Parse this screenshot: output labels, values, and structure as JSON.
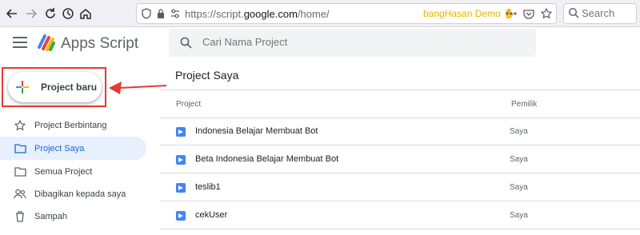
{
  "browser": {
    "url_prefix": "https://script.",
    "url_domain": "google.com",
    "url_path": "/home/",
    "extension_label": "bangHasan Demo",
    "search_placeholder": "Search"
  },
  "app": {
    "title": "Apps Script",
    "search_placeholder": "Cari Nama Project"
  },
  "sidebar": {
    "new_button_label": "Project baru",
    "items": [
      {
        "label": "Project Berbintang",
        "icon": "star-icon"
      },
      {
        "label": "Project Saya",
        "icon": "folder-icon"
      },
      {
        "label": "Semua Project",
        "icon": "folder-icon"
      },
      {
        "label": "Dibagikan kepada saya",
        "icon": "people-icon"
      },
      {
        "label": "Sampah",
        "icon": "trash-icon"
      }
    ],
    "active_index": 1
  },
  "main": {
    "title": "Project Saya",
    "columns": [
      "Project",
      "Pemilik"
    ],
    "rows": [
      {
        "name": "Indonesia Belajar Membuat Bot",
        "owner": "Saya"
      },
      {
        "name": "Beta Indonesia Belajar Membuat Bot",
        "owner": "Saya"
      },
      {
        "name": "teslib1",
        "owner": "Saya"
      },
      {
        "name": "cekUser",
        "owner": "Saya"
      }
    ]
  },
  "colors": {
    "accent_blue": "#1967d2",
    "active_bg": "#e8f0fe",
    "annotation_red": "#e53935",
    "script_icon": "#4285f4"
  }
}
